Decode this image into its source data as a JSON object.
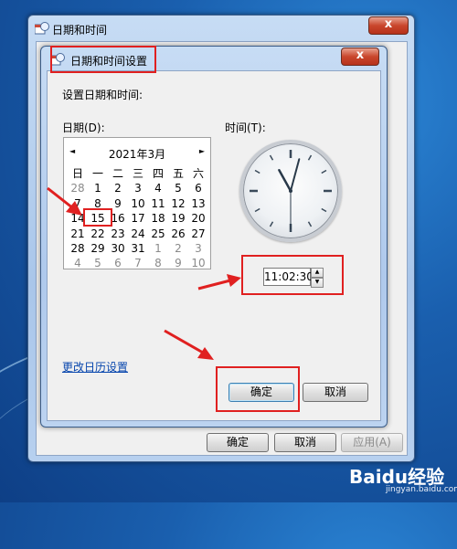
{
  "outer_window": {
    "title": "日期和时间",
    "close_symbol": "x",
    "buttons": {
      "ok": "确定",
      "cancel": "取消",
      "apply": "应用(A)"
    }
  },
  "dialog": {
    "title": "日期和时间设置",
    "close_symbol": "x",
    "instruction": "设置日期和时间:",
    "date_label": "日期(D):",
    "time_label": "时间(T):",
    "calendar": {
      "prev": "◄",
      "next": "►",
      "month_label": "2021年3月",
      "weekdays": [
        "日",
        "一",
        "二",
        "三",
        "四",
        "五",
        "六"
      ],
      "weeks": [
        [
          "28",
          "1",
          "2",
          "3",
          "4",
          "5",
          "6"
        ],
        [
          "7",
          "8",
          "9",
          "10",
          "11",
          "12",
          "13"
        ],
        [
          "14",
          "15",
          "16",
          "17",
          "18",
          "19",
          "20"
        ],
        [
          "21",
          "22",
          "23",
          "24",
          "25",
          "26",
          "27"
        ],
        [
          "28",
          "29",
          "30",
          "31",
          "1",
          "2",
          "3"
        ],
        [
          "4",
          "5",
          "6",
          "7",
          "8",
          "9",
          "10"
        ]
      ],
      "selected_day": "15"
    },
    "clock": {
      "hours": 11,
      "minutes": 2,
      "seconds": 30
    },
    "time_value": "11:02:30",
    "change_calendar_link": "更改日历设置",
    "ok_button": "确定",
    "cancel_button": "取消"
  },
  "watermark": {
    "brand": "Baidu经验",
    "url": "jingyan.baidu.com"
  },
  "colors": {
    "highlight": "#e02020",
    "link": "#0645ad",
    "desktop": "#1a5fae"
  }
}
